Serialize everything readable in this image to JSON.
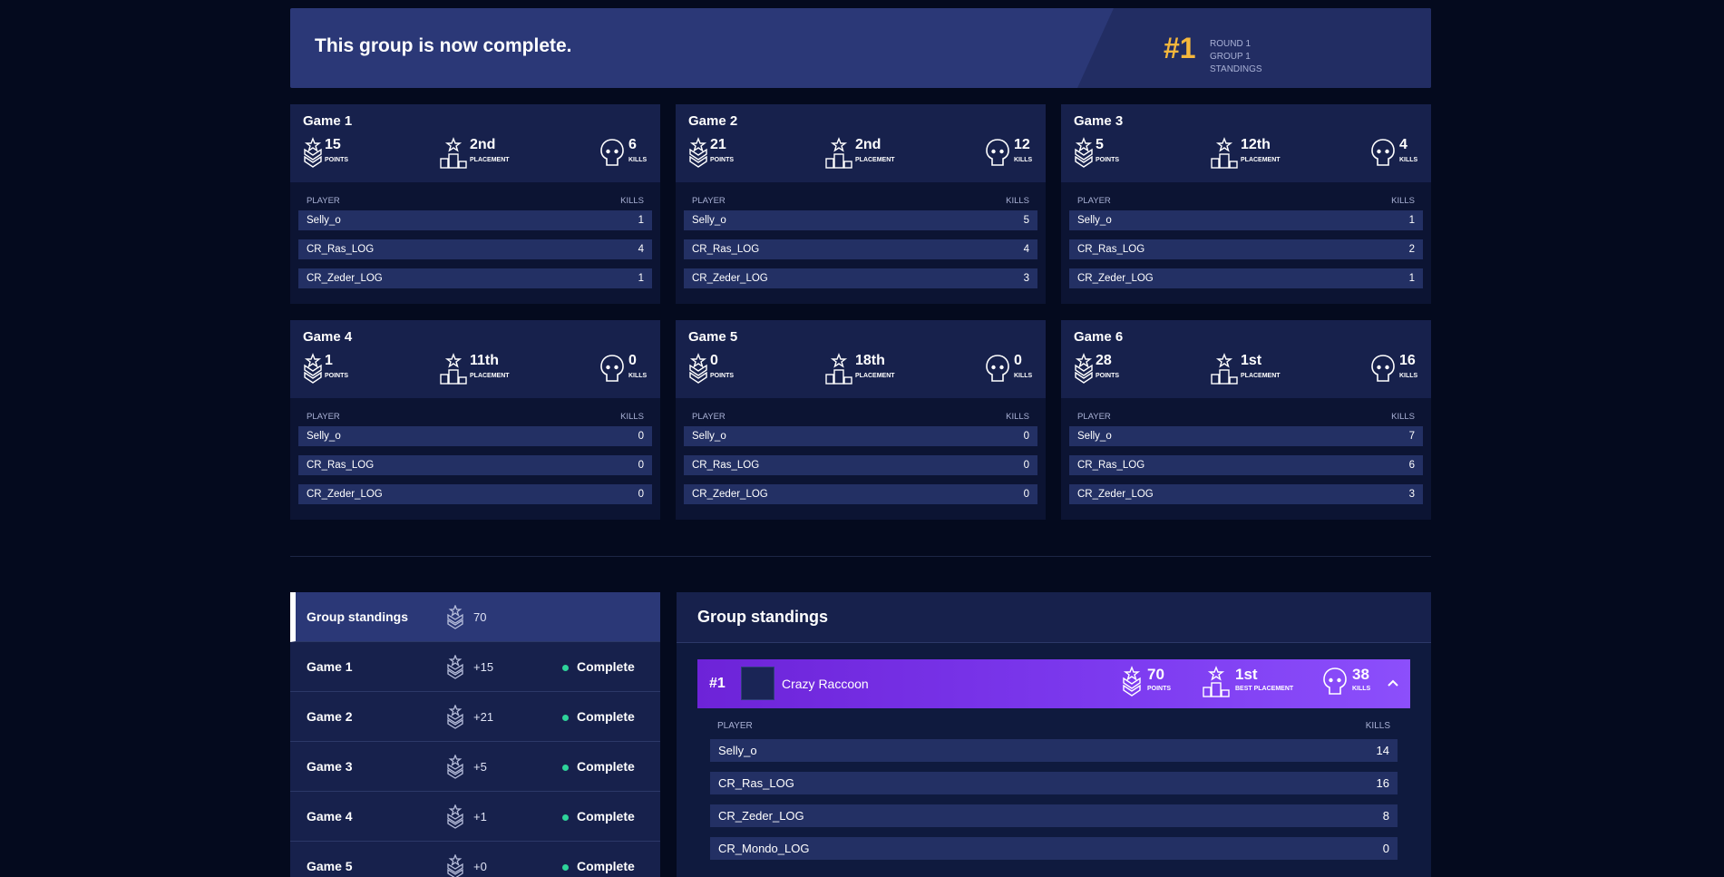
{
  "banner": {
    "title": "This group is now complete.",
    "rank": "#1",
    "meta": [
      "ROUND 1",
      "GROUP 1",
      "STANDINGS"
    ]
  },
  "labels": {
    "points": "POINTS",
    "placement": "PLACEMENT",
    "kills": "KILLS",
    "player": "PLAYER",
    "kills_col": "KILLS",
    "best_placement": "BEST PLACEMENT"
  },
  "games": [
    {
      "title": "Game 1",
      "points": "15",
      "placement": "2nd",
      "kills": "6",
      "players": [
        {
          "name": "Selly_o",
          "kills": "1"
        },
        {
          "name": "CR_Ras_LOG",
          "kills": "4"
        },
        {
          "name": "CR_Zeder_LOG",
          "kills": "1"
        }
      ]
    },
    {
      "title": "Game 2",
      "points": "21",
      "placement": "2nd",
      "kills": "12",
      "players": [
        {
          "name": "Selly_o",
          "kills": "5"
        },
        {
          "name": "CR_Ras_LOG",
          "kills": "4"
        },
        {
          "name": "CR_Zeder_LOG",
          "kills": "3"
        }
      ]
    },
    {
      "title": "Game 3",
      "points": "5",
      "placement": "12th",
      "kills": "4",
      "players": [
        {
          "name": "Selly_o",
          "kills": "1"
        },
        {
          "name": "CR_Ras_LOG",
          "kills": "2"
        },
        {
          "name": "CR_Zeder_LOG",
          "kills": "1"
        }
      ]
    },
    {
      "title": "Game 4",
      "points": "1",
      "placement": "11th",
      "kills": "0",
      "players": [
        {
          "name": "Selly_o",
          "kills": "0"
        },
        {
          "name": "CR_Ras_LOG",
          "kills": "0"
        },
        {
          "name": "CR_Zeder_LOG",
          "kills": "0"
        }
      ]
    },
    {
      "title": "Game 5",
      "points": "0",
      "placement": "18th",
      "kills": "0",
      "players": [
        {
          "name": "Selly_o",
          "kills": "0"
        },
        {
          "name": "CR_Ras_LOG",
          "kills": "0"
        },
        {
          "name": "CR_Zeder_LOG",
          "kills": "0"
        }
      ]
    },
    {
      "title": "Game 6",
      "points": "28",
      "placement": "1st",
      "kills": "16",
      "players": [
        {
          "name": "Selly_o",
          "kills": "7"
        },
        {
          "name": "CR_Ras_LOG",
          "kills": "6"
        },
        {
          "name": "CR_Zeder_LOG",
          "kills": "3"
        }
      ]
    }
  ],
  "nav": [
    {
      "label": "Group standings",
      "points": "70",
      "status": ""
    },
    {
      "label": "Game 1",
      "points": "+15",
      "status": "Complete"
    },
    {
      "label": "Game 2",
      "points": "+21",
      "status": "Complete"
    },
    {
      "label": "Game 3",
      "points": "+5",
      "status": "Complete"
    },
    {
      "label": "Game 4",
      "points": "+1",
      "status": "Complete"
    },
    {
      "label": "Game 5",
      "points": "+0",
      "status": "Complete"
    }
  ],
  "standings": {
    "title": "Group standings",
    "team": {
      "rank": "#1",
      "name": "Crazy Raccoon",
      "points": "70",
      "best_placement": "1st",
      "kills": "38"
    },
    "players": [
      {
        "name": "Selly_o",
        "kills": "14"
      },
      {
        "name": "CR_Ras_LOG",
        "kills": "16"
      },
      {
        "name": "CR_Zeder_LOG",
        "kills": "8"
      },
      {
        "name": "CR_Mondo_LOG",
        "kills": "0"
      }
    ]
  },
  "colors": {
    "background": "#040a1e",
    "rank_gold": "#f5b73c",
    "team_purple": "#7d3bf0",
    "status_green": "#2ed39a"
  },
  "icons": {
    "points": "medal-points-icon",
    "placement": "podium-star-icon",
    "kills": "skull-icon",
    "collapse": "chevron-up-icon"
  }
}
